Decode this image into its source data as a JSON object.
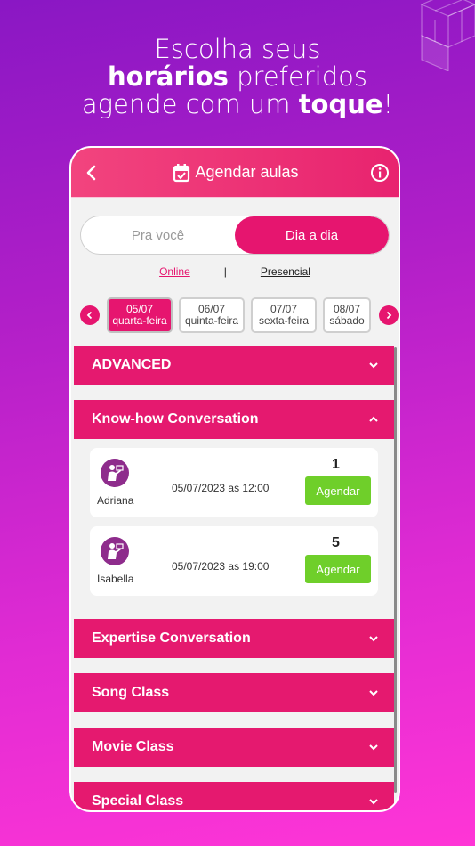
{
  "headline": {
    "line1": "Escolha seus",
    "line2_bold": "horários",
    "line2_rest": " preferidos",
    "line3_pre": "agende com um ",
    "line3_bold": "toque",
    "line3_post": "!"
  },
  "app": {
    "title": "Agendar aulas",
    "icons": {
      "back": "chevron-left-icon",
      "calendar": "calendar-check-icon",
      "info": "info-icon"
    }
  },
  "segment": {
    "options": [
      "Pra você",
      "Dia a dia"
    ],
    "selected": "Dia a dia"
  },
  "modes": {
    "online": "Online",
    "separator": "|",
    "presencial": "Presencial",
    "selected": "Online"
  },
  "dates": [
    {
      "date": "05/07",
      "weekday": "quarta-feira",
      "selected": true
    },
    {
      "date": "06/07",
      "weekday": "quinta-feira",
      "selected": false
    },
    {
      "date": "07/07",
      "weekday": "sexta-feira",
      "selected": false
    },
    {
      "date": "08/07",
      "weekday": "sábado",
      "selected": false
    }
  ],
  "sections": [
    {
      "title": "ADVANCED",
      "expanded": false
    },
    {
      "title": "Know-how Conversation",
      "expanded": true,
      "slots": [
        {
          "teacher": "Adriana",
          "datetime": "05/07/2023 as 12:00",
          "count": "1",
          "button": "Agendar"
        },
        {
          "teacher": "Isabella",
          "datetime": "05/07/2023 as 19:00",
          "count": "5",
          "button": "Agendar"
        }
      ]
    },
    {
      "title": "Expertise Conversation",
      "expanded": false
    },
    {
      "title": "Song Class",
      "expanded": false
    },
    {
      "title": "Movie Class",
      "expanded": false
    },
    {
      "title": "Special Class",
      "expanded": false
    }
  ],
  "colors": {
    "accent": "#e6156f",
    "book_button": "#6fcf2a",
    "avatar": "#8e2c8c"
  }
}
